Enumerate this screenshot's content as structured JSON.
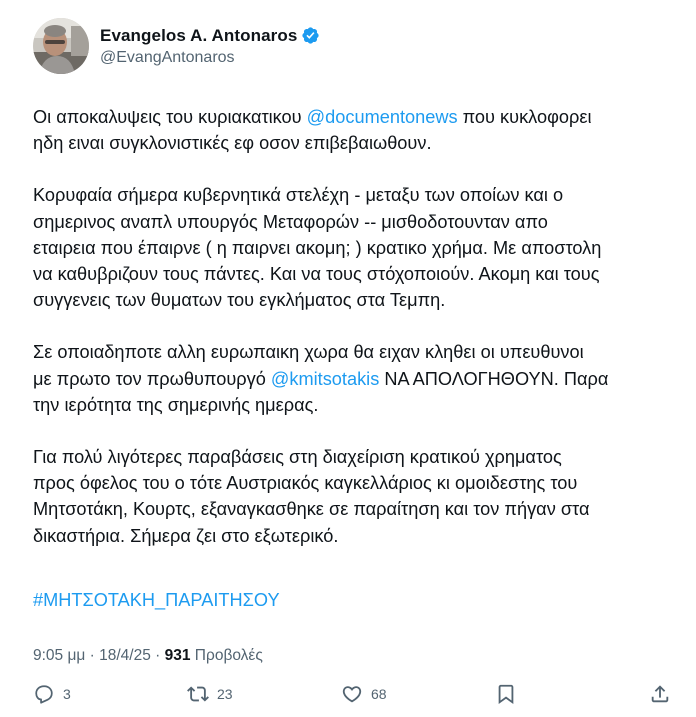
{
  "author": {
    "display_name": "Evangelos A. Antonaros",
    "handle": "@EvangAntonaros",
    "verified": true
  },
  "tweet": {
    "paragraphs": [
      {
        "lines": [
          {
            "pre": "Οι αποκαλυψεις του κυριακατικου ",
            "mention": "@documentonews",
            "post": " που κυκλοφορει"
          },
          {
            "pre": "ηδη ειναι συγκλονιστικές εφ οσον επιβεβαιωθουν.",
            "mention": "",
            "post": ""
          }
        ]
      },
      {
        "lines": [
          {
            "pre": "Κορυφαία σήμερα κυβερνητικά στελέχη - μεταξυ των οποίων και ο",
            "mention": "",
            "post": ""
          },
          {
            "pre": "σημερινος αναπλ υπουργός Μεταφορών -- μισθοδοτουνταν απο",
            "mention": "",
            "post": ""
          },
          {
            "pre": "εταιρεια που έπαιρνε ( η παιρνει ακομη; ) κρατικο χρήμα. Με αποστολη",
            "mention": "",
            "post": ""
          },
          {
            "pre": "να καθυβριζουν τους πάντες. Και να τους στόχοποιούν. Ακομη και τους",
            "mention": "",
            "post": ""
          },
          {
            "pre": "συγγενεις των θυματων του εγκλήματος στα Τεμπη.",
            "mention": "",
            "post": ""
          }
        ]
      },
      {
        "lines": [
          {
            "pre": "Σε οποιαδηποτε αλλη ευρωπαικη χωρα θα ειχαν κληθει οι υπευθυνοι",
            "mention": "",
            "post": ""
          },
          {
            "pre": "με πρωτο τον πρωθυπουργό ",
            "mention": "@kmitsotakis",
            "post": " ΝΑ ΑΠΟΛΟΓΗΘΟΥΝ. Παρα"
          },
          {
            "pre": "την ιερότητα της σημερινής ημερας.",
            "mention": "",
            "post": ""
          }
        ]
      },
      {
        "lines": [
          {
            "pre": "Για πολύ λιγότερες παραβάσεις στη διαχείριση κρατικού χρηματος",
            "mention": "",
            "post": ""
          },
          {
            "pre": "προς όφελος του ο τότε  Αυστριακός καγκελλάριος κι ομοιδεστης του",
            "mention": "",
            "post": ""
          },
          {
            "pre": "Μητσοτάκη, Κουρτς, εξαναγκασθηκε σε παραίτηση και τον πήγαν στα",
            "mention": "",
            "post": ""
          },
          {
            "pre": "δικαστήρια. Σήμερα ζει στο εξωτερικό.",
            "mention": "",
            "post": ""
          }
        ]
      }
    ],
    "hashtag": "#ΜΗΤΣΟΤΑΚΗ_ΠΑΡΑΙΤΗΣΟΥ"
  },
  "meta": {
    "time": "9:05 μμ",
    "separator": " · ",
    "date": "18/4/25",
    "views_count": "931",
    "views_label": " Προβολές"
  },
  "actions": {
    "replies": "3",
    "reposts": "23",
    "likes": "68"
  },
  "colors": {
    "link": "#1d9bf0",
    "secondary": "#536471",
    "text": "#0f1419"
  },
  "icons": [
    "reply-icon",
    "repost-icon",
    "like-icon",
    "bookmark-icon",
    "share-icon",
    "verified-badge-icon"
  ]
}
